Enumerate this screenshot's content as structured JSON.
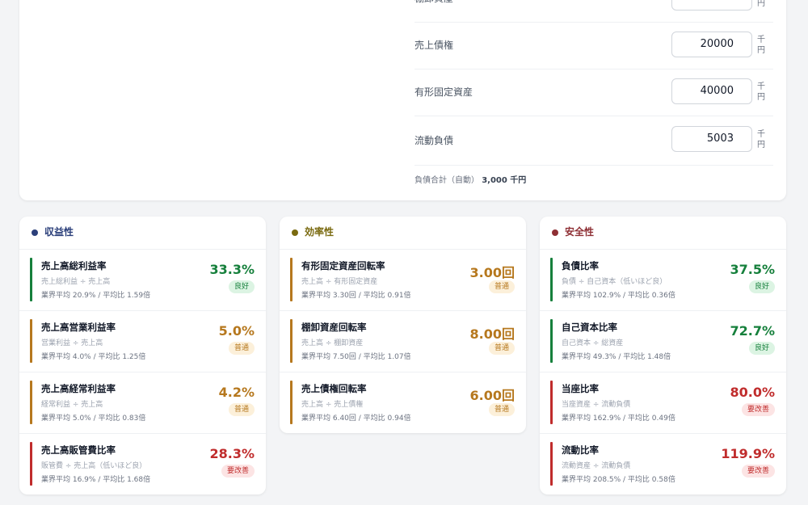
{
  "colors": {
    "good": "#16803c",
    "good_bg": "#dcf4e3",
    "normal": "#b6781e",
    "normal_bg": "#fcf0da",
    "bad": "#c02c2c",
    "bad_bg": "#fce4e4",
    "dot_profit": "#2b3f7a",
    "dot_eff": "#7a6a10",
    "dot_safety": "#8e2f34",
    "title_profit": "#2b3f7a",
    "title_eff": "#7a6a10",
    "title_safety": "#8e2f34"
  },
  "form": {
    "fields": [
      {
        "label": "棚卸資産",
        "value": "",
        "unit": "千円"
      },
      {
        "label": "売上債権",
        "value": "20000",
        "unit": "千円"
      },
      {
        "label": "有形固定資産",
        "value": "40000",
        "unit": "千円"
      },
      {
        "label": "流動負債",
        "value": "5003",
        "unit": "千円"
      }
    ],
    "total_label": "負債合計（自動）",
    "total_value": "3,000 千円"
  },
  "categories": [
    {
      "title": "収益性",
      "dot": "dot_profit",
      "title_color": "title_profit",
      "metrics": [
        {
          "name": "売上高総利益率",
          "formula": "売上総利益 ÷ 売上高",
          "bench": "業界平均 20.9% / 平均比 1.59倍",
          "value": "33.3%",
          "badge": "良好",
          "status": "good"
        },
        {
          "name": "売上高営業利益率",
          "formula": "営業利益 ÷ 売上高",
          "bench": "業界平均 4.0% / 平均比 1.25倍",
          "value": "5.0%",
          "badge": "普通",
          "status": "normal"
        },
        {
          "name": "売上高経常利益率",
          "formula": "経常利益 ÷ 売上高",
          "bench": "業界平均 5.0% / 平均比 0.83倍",
          "value": "4.2%",
          "badge": "普通",
          "status": "normal"
        },
        {
          "name": "売上高販管費比率",
          "formula": "販管費 ÷ 売上高（低いほど良）",
          "bench": "業界平均 16.9% / 平均比 1.68倍",
          "value": "28.3%",
          "badge": "要改善",
          "status": "bad"
        }
      ]
    },
    {
      "title": "効率性",
      "dot": "dot_eff",
      "title_color": "title_eff",
      "metrics": [
        {
          "name": "有形固定資産回転率",
          "formula": "売上高 ÷ 有形固定資産",
          "bench": "業界平均 3.30回 / 平均比 0.91倍",
          "value": "3.00回",
          "badge": "普通",
          "status": "normal"
        },
        {
          "name": "棚卸資産回転率",
          "formula": "売上高 ÷ 棚卸資産",
          "bench": "業界平均 7.50回 / 平均比 1.07倍",
          "value": "8.00回",
          "badge": "普通",
          "status": "normal"
        },
        {
          "name": "売上債権回転率",
          "formula": "売上高 ÷ 売上債権",
          "bench": "業界平均 6.40回 / 平均比 0.94倍",
          "value": "6.00回",
          "badge": "普通",
          "status": "normal"
        }
      ]
    },
    {
      "title": "安全性",
      "dot": "dot_safety",
      "title_color": "title_safety",
      "metrics": [
        {
          "name": "負債比率",
          "formula": "負債 ÷ 自己資本（低いほど良）",
          "bench": "業界平均 102.9% / 平均比 0.36倍",
          "value": "37.5%",
          "badge": "良好",
          "status": "good"
        },
        {
          "name": "自己資本比率",
          "formula": "自己資本 ÷ 総資産",
          "bench": "業界平均 49.3% / 平均比 1.48倍",
          "value": "72.7%",
          "badge": "良好",
          "status": "good"
        },
        {
          "name": "当座比率",
          "formula": "当座資産 ÷ 流動負債",
          "bench": "業界平均 162.9% / 平均比 0.49倍",
          "value": "80.0%",
          "badge": "要改善",
          "status": "bad"
        },
        {
          "name": "流動比率",
          "formula": "流動資産 ÷ 流動負債",
          "bench": "業界平均 208.5% / 平均比 0.58倍",
          "value": "119.9%",
          "badge": "要改善",
          "status": "bad"
        }
      ]
    }
  ]
}
